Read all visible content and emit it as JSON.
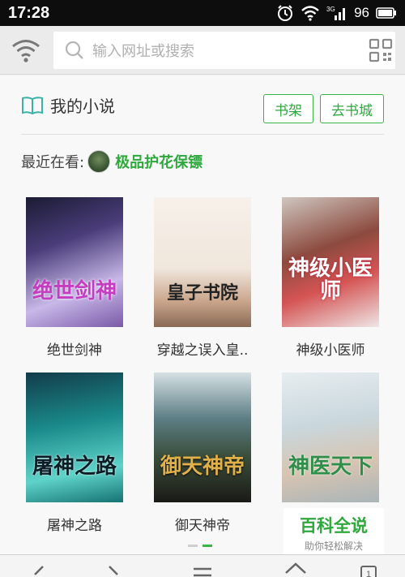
{
  "status_bar": {
    "time": "17:28",
    "network": "3G",
    "battery": "96"
  },
  "address_bar": {
    "placeholder": "输入网址或搜索"
  },
  "novel_section": {
    "title": "我的小说",
    "bookshelf_label": "书架",
    "bookstore_label": "去书城",
    "recent_prefix": "最近在看:",
    "recent_book": "极品护花保镖"
  },
  "books": [
    {
      "label": "绝世剑神",
      "cover_title": "绝世剑神"
    },
    {
      "label": "穿越之误入皇..",
      "cover_title": "皇子书院"
    },
    {
      "label": "神级小医师",
      "cover_title": "神级小医师"
    },
    {
      "label": "屠神之路",
      "cover_title": "屠神之路"
    },
    {
      "label": "御天神帝",
      "cover_title": "御天神帝"
    },
    {
      "label": "",
      "cover_title": "神医天下"
    }
  ],
  "watermark": {
    "title": "百科全说",
    "subtitle": "助你轻松解决"
  },
  "colors": {
    "accent": "#3bb54a",
    "status_bar": "#0d0d0d"
  }
}
